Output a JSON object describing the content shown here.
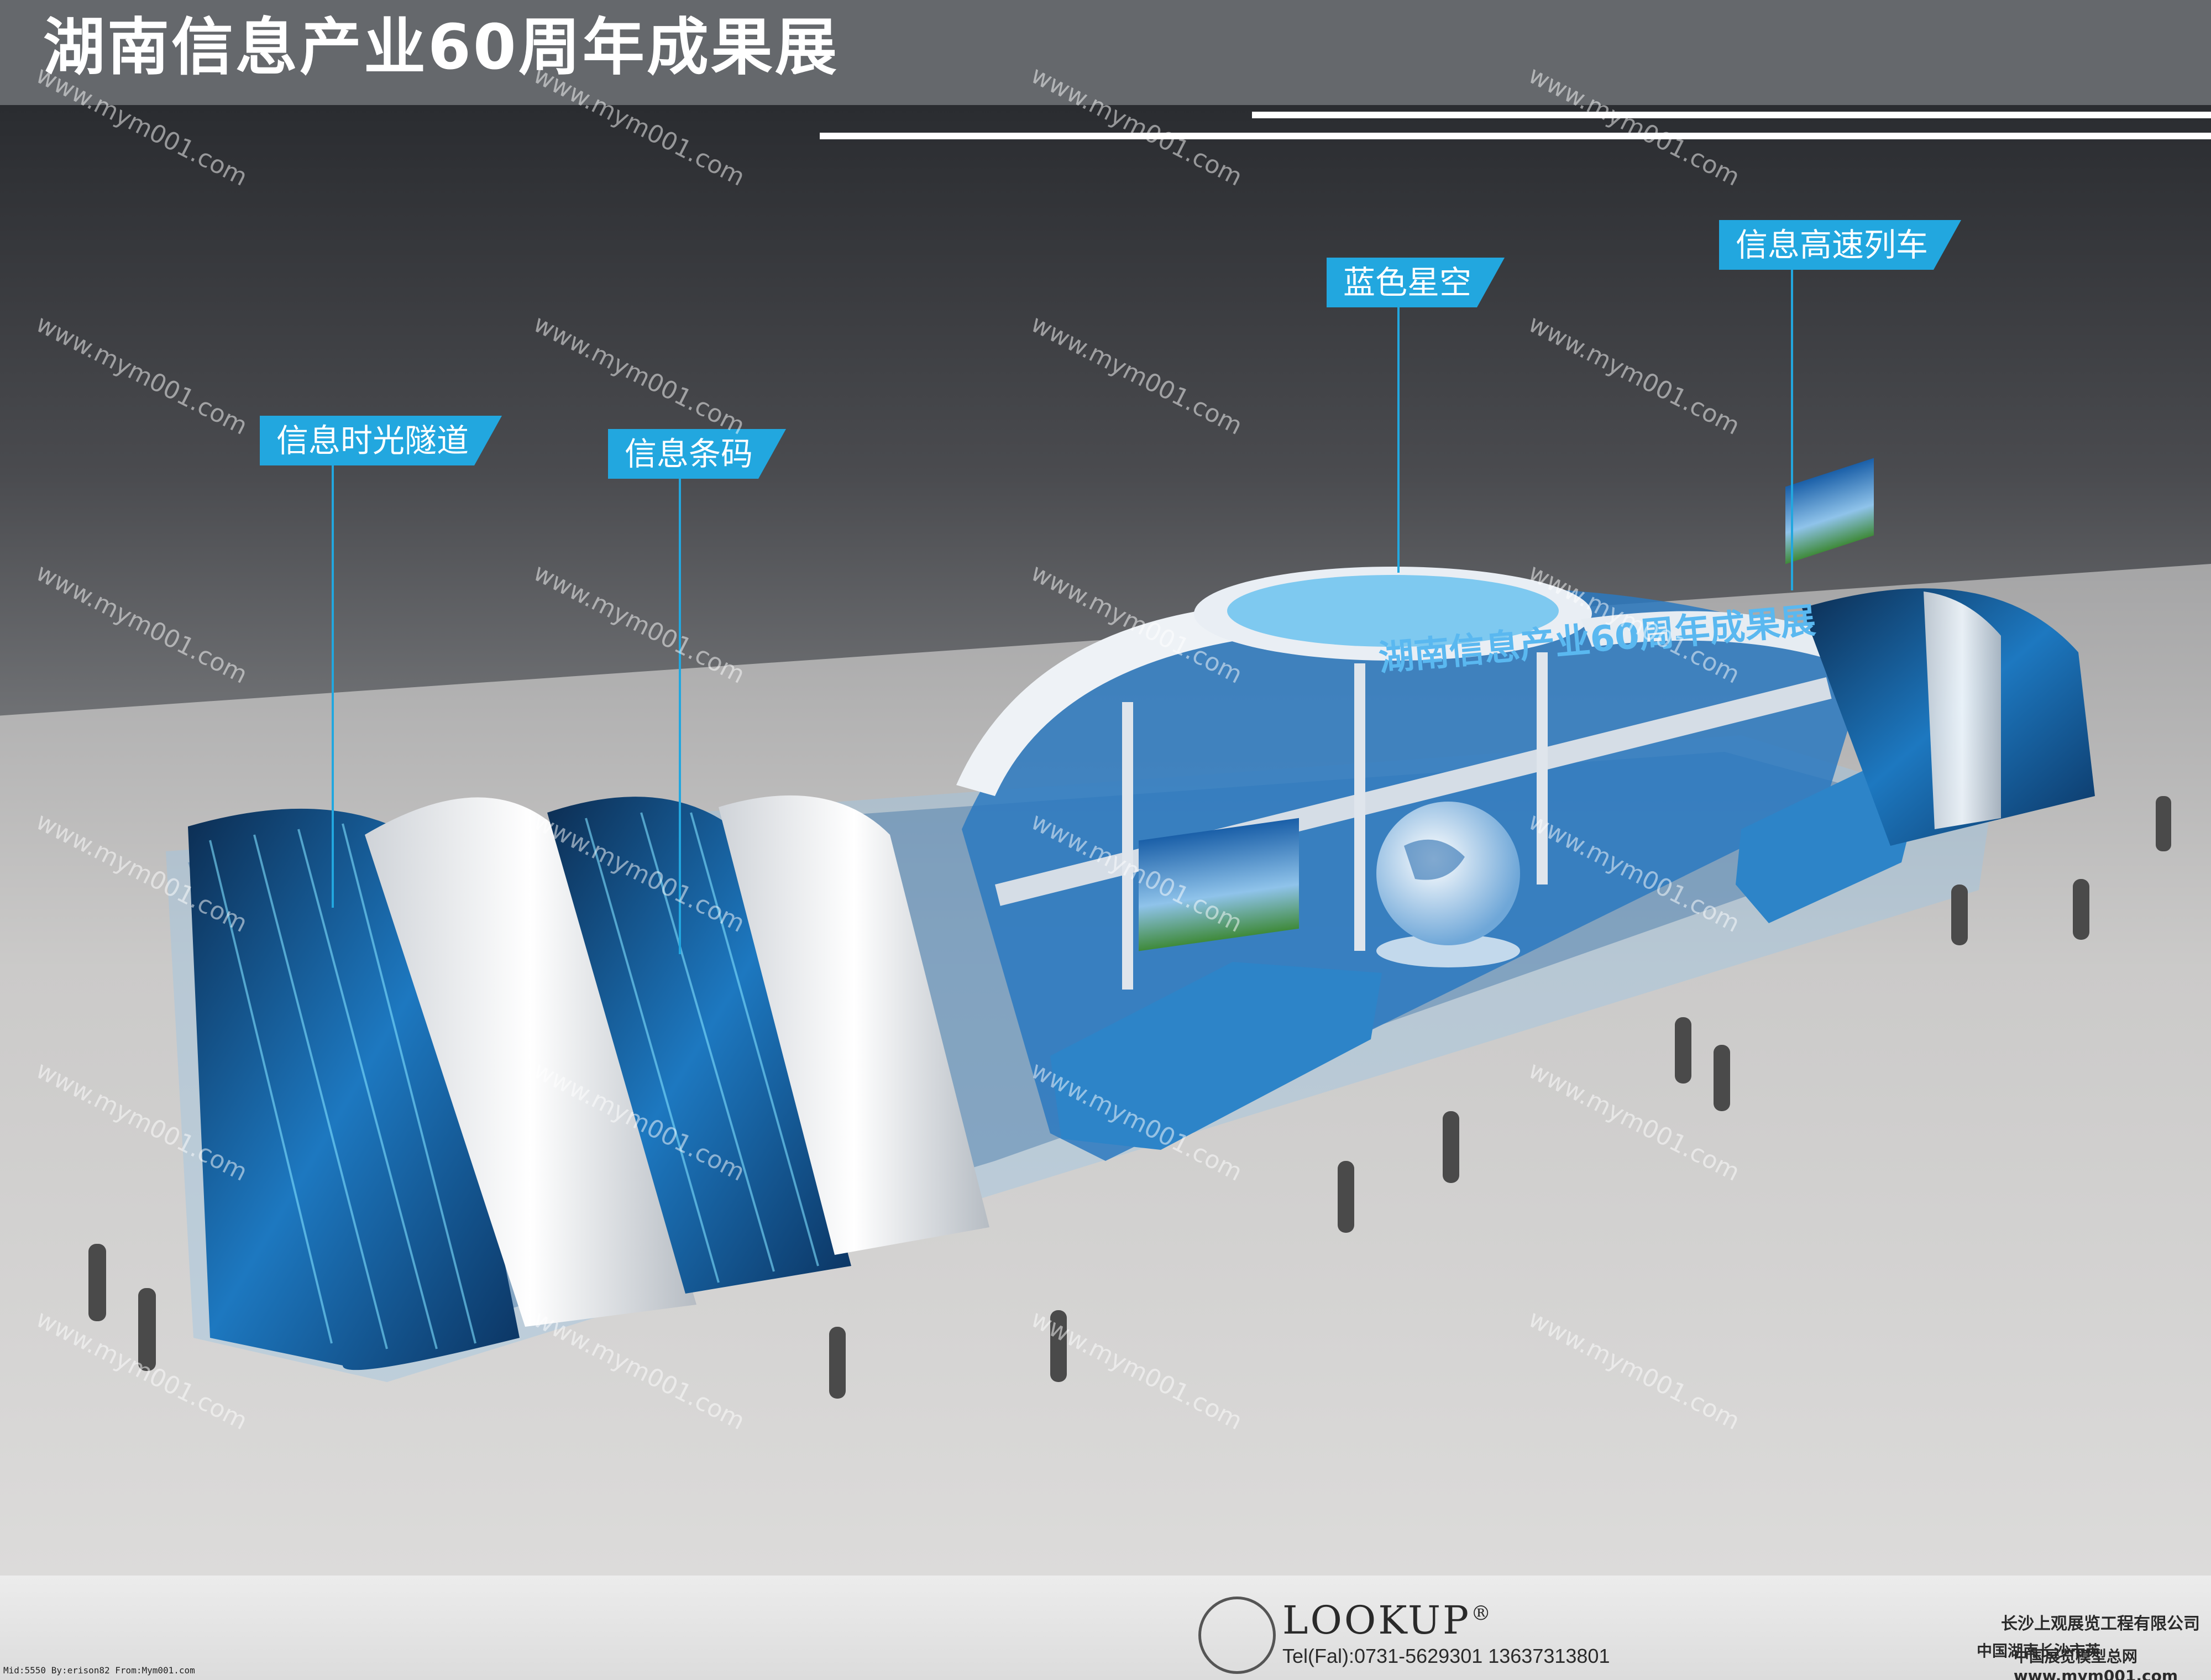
{
  "header": {
    "title": "湖南信息产业60周年成果展"
  },
  "zones": [
    {
      "label": "信息时光隧道"
    },
    {
      "label": "信息条码"
    },
    {
      "label": "蓝色星空"
    },
    {
      "label": "信息高速列车"
    }
  ],
  "booth": {
    "fascia": "湖南信息产业60周年成果展"
  },
  "watermark": "www.mym001.com",
  "footer": {
    "brand": "LOOKUP",
    "reg": "®",
    "tel": "Tel(Fal):0731-5629301  13637313801",
    "company": "长沙上观展览工程有限公司",
    "address": "中国湖南长沙市芙",
    "site_name": "中国展览模型总网",
    "site_url": "www.mym001.com",
    "credit": "Mid:5550 By:erison82 From:Mym001.com"
  },
  "colors": {
    "accent": "#22a7df",
    "header": "#65686c",
    "booth_blue": "#1a6fb0"
  }
}
